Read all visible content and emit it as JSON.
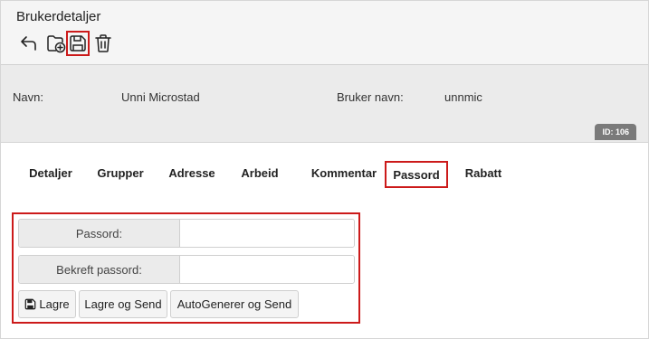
{
  "header": {
    "title": "Brukerdetaljer",
    "toolbar": [
      {
        "name": "back-arrow-icon",
        "state": "normal"
      },
      {
        "name": "add-folder-icon",
        "state": "normal"
      },
      {
        "name": "save-icon",
        "state": "highlighted"
      },
      {
        "name": "trash-icon",
        "state": "normal"
      }
    ]
  },
  "user_info": {
    "name_label": "Navn:",
    "name_value": "Unni Microstad",
    "username_label": "Bruker navn:",
    "username_value": "unnmic",
    "id_badge": "ID: 106"
  },
  "tabs": [
    {
      "label": "Detaljer"
    },
    {
      "label": "Grupper"
    },
    {
      "label": "Adresse"
    },
    {
      "label": "Arbeid"
    },
    {
      "label": "Kommentar"
    },
    {
      "label": "Passord",
      "active": true
    },
    {
      "label": "Rabatt"
    }
  ],
  "password_form": {
    "password_label": "Passord:",
    "password_value": "",
    "confirm_label": "Bekreft passord:",
    "confirm_value": "",
    "buttons": {
      "save": "Lagre",
      "save_send": "Lagre og Send",
      "autogen_send": "AutoGenerer og Send"
    }
  },
  "colors": {
    "highlight": "#cc1a1a",
    "header_bg": "#f5f5f5",
    "info_bg": "#ebebeb",
    "badge_bg": "#7a7a7a"
  }
}
